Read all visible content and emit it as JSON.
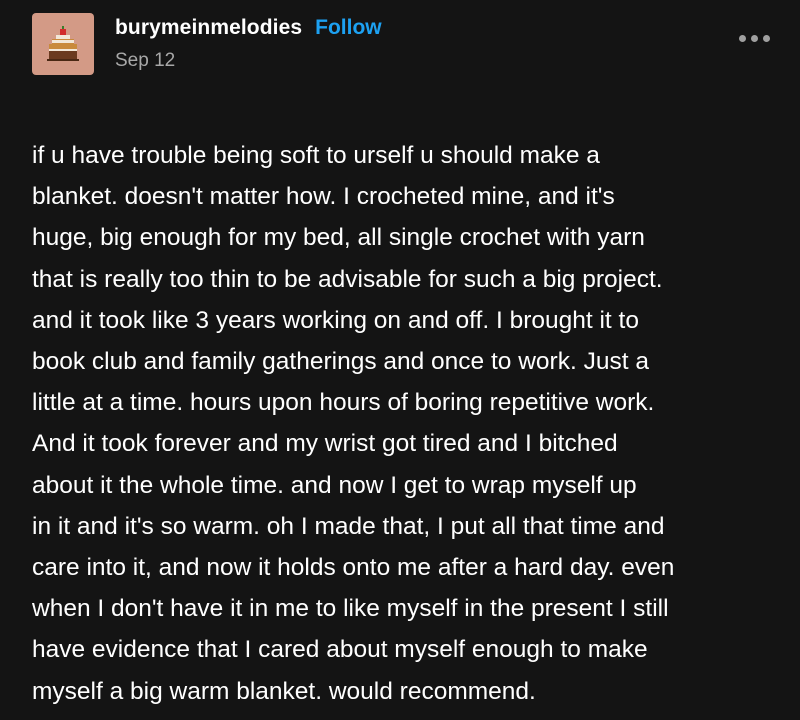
{
  "post": {
    "username": "burymeinmelodies",
    "follow_label": "Follow",
    "date": "Sep 12",
    "more_icon": "ellipsis-icon",
    "avatar_icon": "cake-avatar",
    "body_text": "if u have trouble being soft to urself u should make a\nblanket. doesn't matter how. I crocheted mine, and it's\nhuge, big enough for my bed, all single crochet with yarn\nthat is really too thin to be advisable for such a big project.\nand it took like 3 years working on and off. I brought it to\nbook club and family gatherings and once to work. Just a\nlittle at a time. hours upon hours of boring repetitive work.\nAnd it took forever and my wrist got tired and I bitched\nabout it the whole time. and now I get to wrap myself up\nin it and it's so warm. oh I made that, I put all that time and\ncare into it, and now it holds onto me after a hard day. even\nwhen I don't have it in me to like myself in the present I still\nhave evidence that I cared about myself enough to make\nmyself a big warm blanket. would recommend."
  },
  "colors": {
    "background": "#141414",
    "text": "#ffffff",
    "follow": "#1da1f2",
    "muted": "#a8a8a8",
    "avatar_bg": "#d39a86"
  }
}
